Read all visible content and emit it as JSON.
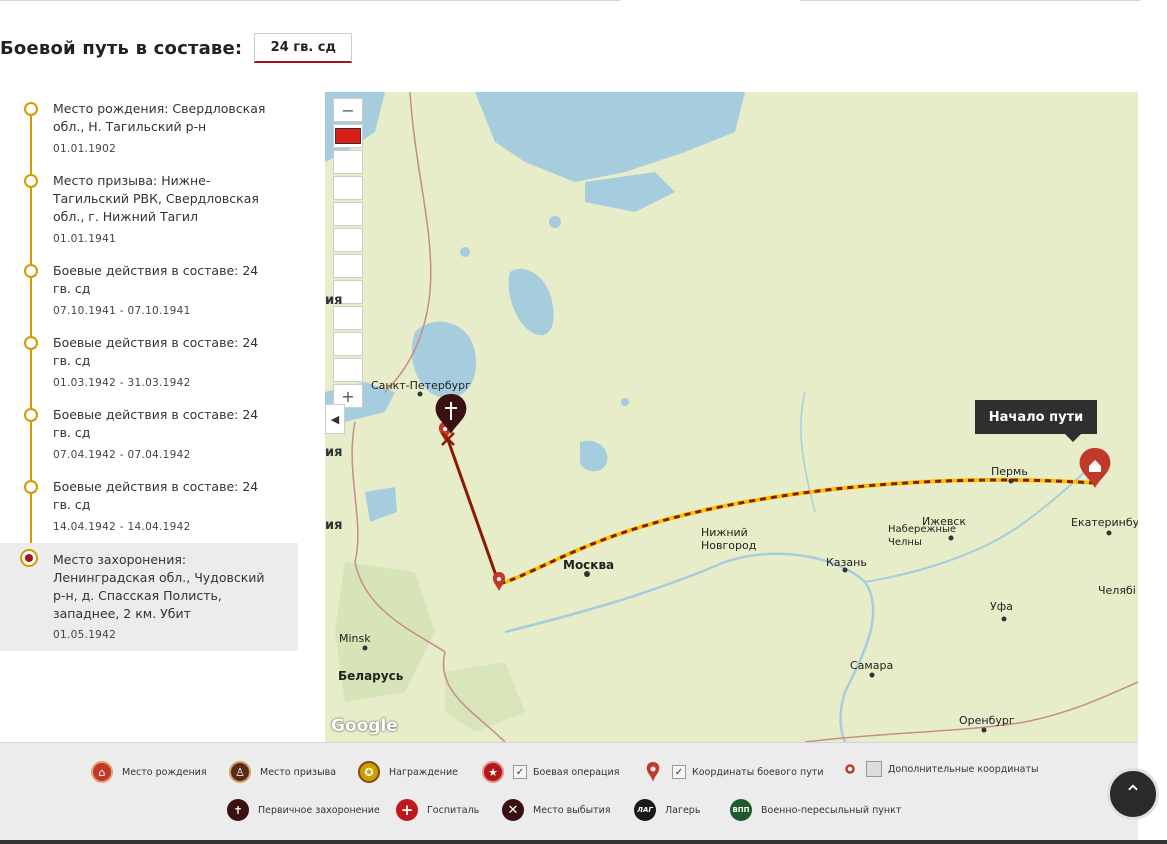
{
  "header": {
    "title": "Боевой путь в составе:",
    "unit": "24 гв. сд"
  },
  "timeline": [
    {
      "text": "Место рождения: Свердловская обл., Н. Тагильский р-н",
      "date": "01.01.1902"
    },
    {
      "text": "Место призыва: Нижне-Тагильский РВК, Свердловская обл., г. Нижний Тагил",
      "date": "01.01.1941"
    },
    {
      "text": "Боевые действия в составе: 24 гв. сд",
      "date": "07.10.1941 - 07.10.1941"
    },
    {
      "text": "Боевые действия в составе: 24 гв. сд",
      "date": "01.03.1942 - 31.03.1942"
    },
    {
      "text": "Боевые действия в составе: 24 гв. сд",
      "date": "07.04.1942 - 07.04.1942"
    },
    {
      "text": "Боевые действия в составе: 24 гв. сд",
      "date": "14.04.1942 - 14.04.1942"
    },
    {
      "text": "Место захоронения: Ленинградская обл., Чудовский р-н, д. Спасская Полисть, западнее, 2 км. Убит",
      "date": "01.05.1942"
    }
  ],
  "map": {
    "tooltip": "Начало пути",
    "zoom_in": "+",
    "zoom_out": "−",
    "collapse": "◀",
    "attribution": "Google",
    "cities": {
      "spb": "Санкт-Петербург",
      "moscow": "Москва",
      "nnovgorod": "Нижний Новгород",
      "kazan": "Казань",
      "chelny": "Набережные Челны",
      "izhevsk": "Ижевск",
      "perm": "Пермь",
      "ekb": "Екатеринбург",
      "ufa": "Уфа",
      "samara": "Самара",
      "orenburg": "Оренбург",
      "chelyab": "Челябі",
      "minsk": "Minsk",
      "belarus": "Беларусь"
    },
    "edge_labels": [
      "ия",
      "ия",
      "ия"
    ],
    "colors": {
      "route": "#8b1a00",
      "dash_bg": "#f2c500",
      "pin": "#c0392b",
      "pin_dark": "#3b1010"
    }
  },
  "legend": {
    "birth": "Место рождения",
    "draft": "Место призыва",
    "award": "Награждение",
    "battle": "Боевая операция",
    "coords": "Координаты боевого пути",
    "extra": "Дополнительные координаты",
    "burial": "Первичное захоронение",
    "hospital": "Госпиталь",
    "departure": "Место выбытия",
    "camp": "Лагерь",
    "transit": "Военно-пересыльный пункт",
    "camp_icon": "ЛАГ",
    "transit_icon": "ВПП",
    "check": "✓"
  },
  "scroll_top": "⌃"
}
